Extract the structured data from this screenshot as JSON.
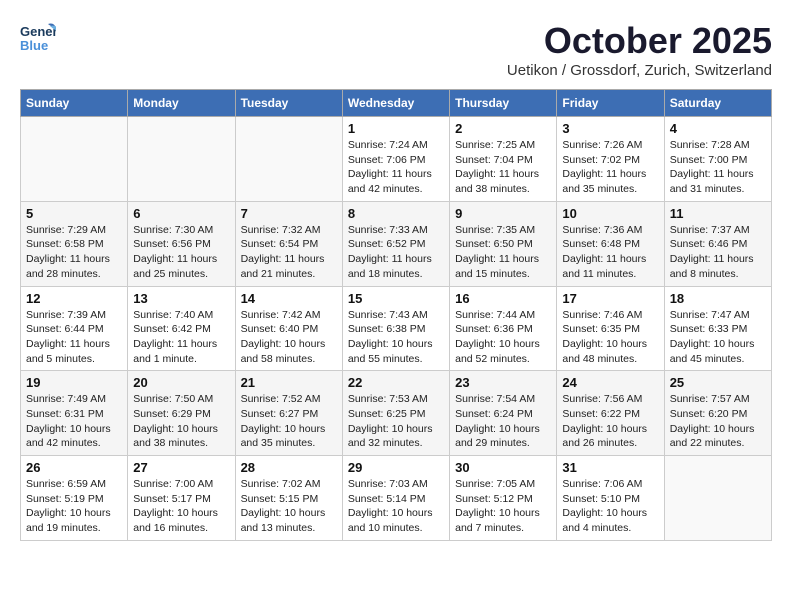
{
  "header": {
    "logo_line1": "General",
    "logo_line2": "Blue",
    "month": "October 2025",
    "location": "Uetikon / Grossdorf, Zurich, Switzerland"
  },
  "weekdays": [
    "Sunday",
    "Monday",
    "Tuesday",
    "Wednesday",
    "Thursday",
    "Friday",
    "Saturday"
  ],
  "weeks": [
    [
      {
        "day": "",
        "sunrise": "",
        "sunset": "",
        "daylight": ""
      },
      {
        "day": "",
        "sunrise": "",
        "sunset": "",
        "daylight": ""
      },
      {
        "day": "",
        "sunrise": "",
        "sunset": "",
        "daylight": ""
      },
      {
        "day": "1",
        "sunrise": "Sunrise: 7:24 AM",
        "sunset": "Sunset: 7:06 PM",
        "daylight": "Daylight: 11 hours and 42 minutes."
      },
      {
        "day": "2",
        "sunrise": "Sunrise: 7:25 AM",
        "sunset": "Sunset: 7:04 PM",
        "daylight": "Daylight: 11 hours and 38 minutes."
      },
      {
        "day": "3",
        "sunrise": "Sunrise: 7:26 AM",
        "sunset": "Sunset: 7:02 PM",
        "daylight": "Daylight: 11 hours and 35 minutes."
      },
      {
        "day": "4",
        "sunrise": "Sunrise: 7:28 AM",
        "sunset": "Sunset: 7:00 PM",
        "daylight": "Daylight: 11 hours and 31 minutes."
      }
    ],
    [
      {
        "day": "5",
        "sunrise": "Sunrise: 7:29 AM",
        "sunset": "Sunset: 6:58 PM",
        "daylight": "Daylight: 11 hours and 28 minutes."
      },
      {
        "day": "6",
        "sunrise": "Sunrise: 7:30 AM",
        "sunset": "Sunset: 6:56 PM",
        "daylight": "Daylight: 11 hours and 25 minutes."
      },
      {
        "day": "7",
        "sunrise": "Sunrise: 7:32 AM",
        "sunset": "Sunset: 6:54 PM",
        "daylight": "Daylight: 11 hours and 21 minutes."
      },
      {
        "day": "8",
        "sunrise": "Sunrise: 7:33 AM",
        "sunset": "Sunset: 6:52 PM",
        "daylight": "Daylight: 11 hours and 18 minutes."
      },
      {
        "day": "9",
        "sunrise": "Sunrise: 7:35 AM",
        "sunset": "Sunset: 6:50 PM",
        "daylight": "Daylight: 11 hours and 15 minutes."
      },
      {
        "day": "10",
        "sunrise": "Sunrise: 7:36 AM",
        "sunset": "Sunset: 6:48 PM",
        "daylight": "Daylight: 11 hours and 11 minutes."
      },
      {
        "day": "11",
        "sunrise": "Sunrise: 7:37 AM",
        "sunset": "Sunset: 6:46 PM",
        "daylight": "Daylight: 11 hours and 8 minutes."
      }
    ],
    [
      {
        "day": "12",
        "sunrise": "Sunrise: 7:39 AM",
        "sunset": "Sunset: 6:44 PM",
        "daylight": "Daylight: 11 hours and 5 minutes."
      },
      {
        "day": "13",
        "sunrise": "Sunrise: 7:40 AM",
        "sunset": "Sunset: 6:42 PM",
        "daylight": "Daylight: 11 hours and 1 minute."
      },
      {
        "day": "14",
        "sunrise": "Sunrise: 7:42 AM",
        "sunset": "Sunset: 6:40 PM",
        "daylight": "Daylight: 10 hours and 58 minutes."
      },
      {
        "day": "15",
        "sunrise": "Sunrise: 7:43 AM",
        "sunset": "Sunset: 6:38 PM",
        "daylight": "Daylight: 10 hours and 55 minutes."
      },
      {
        "day": "16",
        "sunrise": "Sunrise: 7:44 AM",
        "sunset": "Sunset: 6:36 PM",
        "daylight": "Daylight: 10 hours and 52 minutes."
      },
      {
        "day": "17",
        "sunrise": "Sunrise: 7:46 AM",
        "sunset": "Sunset: 6:35 PM",
        "daylight": "Daylight: 10 hours and 48 minutes."
      },
      {
        "day": "18",
        "sunrise": "Sunrise: 7:47 AM",
        "sunset": "Sunset: 6:33 PM",
        "daylight": "Daylight: 10 hours and 45 minutes."
      }
    ],
    [
      {
        "day": "19",
        "sunrise": "Sunrise: 7:49 AM",
        "sunset": "Sunset: 6:31 PM",
        "daylight": "Daylight: 10 hours and 42 minutes."
      },
      {
        "day": "20",
        "sunrise": "Sunrise: 7:50 AM",
        "sunset": "Sunset: 6:29 PM",
        "daylight": "Daylight: 10 hours and 38 minutes."
      },
      {
        "day": "21",
        "sunrise": "Sunrise: 7:52 AM",
        "sunset": "Sunset: 6:27 PM",
        "daylight": "Daylight: 10 hours and 35 minutes."
      },
      {
        "day": "22",
        "sunrise": "Sunrise: 7:53 AM",
        "sunset": "Sunset: 6:25 PM",
        "daylight": "Daylight: 10 hours and 32 minutes."
      },
      {
        "day": "23",
        "sunrise": "Sunrise: 7:54 AM",
        "sunset": "Sunset: 6:24 PM",
        "daylight": "Daylight: 10 hours and 29 minutes."
      },
      {
        "day": "24",
        "sunrise": "Sunrise: 7:56 AM",
        "sunset": "Sunset: 6:22 PM",
        "daylight": "Daylight: 10 hours and 26 minutes."
      },
      {
        "day": "25",
        "sunrise": "Sunrise: 7:57 AM",
        "sunset": "Sunset: 6:20 PM",
        "daylight": "Daylight: 10 hours and 22 minutes."
      }
    ],
    [
      {
        "day": "26",
        "sunrise": "Sunrise: 6:59 AM",
        "sunset": "Sunset: 5:19 PM",
        "daylight": "Daylight: 10 hours and 19 minutes."
      },
      {
        "day": "27",
        "sunrise": "Sunrise: 7:00 AM",
        "sunset": "Sunset: 5:17 PM",
        "daylight": "Daylight: 10 hours and 16 minutes."
      },
      {
        "day": "28",
        "sunrise": "Sunrise: 7:02 AM",
        "sunset": "Sunset: 5:15 PM",
        "daylight": "Daylight: 10 hours and 13 minutes."
      },
      {
        "day": "29",
        "sunrise": "Sunrise: 7:03 AM",
        "sunset": "Sunset: 5:14 PM",
        "daylight": "Daylight: 10 hours and 10 minutes."
      },
      {
        "day": "30",
        "sunrise": "Sunrise: 7:05 AM",
        "sunset": "Sunset: 5:12 PM",
        "daylight": "Daylight: 10 hours and 7 minutes."
      },
      {
        "day": "31",
        "sunrise": "Sunrise: 7:06 AM",
        "sunset": "Sunset: 5:10 PM",
        "daylight": "Daylight: 10 hours and 4 minutes."
      },
      {
        "day": "",
        "sunrise": "",
        "sunset": "",
        "daylight": ""
      }
    ]
  ]
}
